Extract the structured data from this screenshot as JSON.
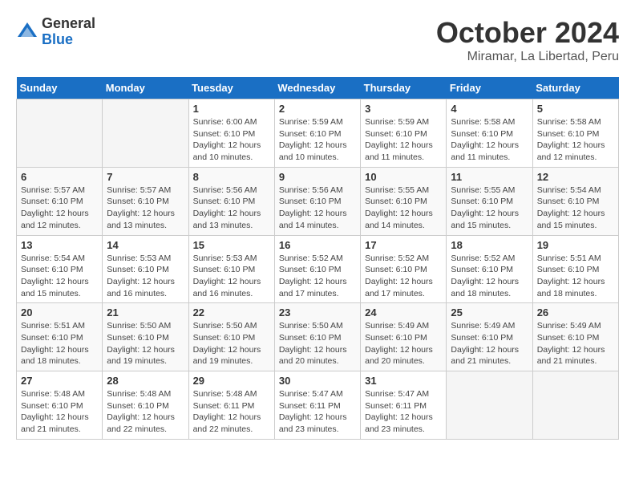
{
  "logo": {
    "general": "General",
    "blue": "Blue"
  },
  "title": "October 2024",
  "location": "Miramar, La Libertad, Peru",
  "days_of_week": [
    "Sunday",
    "Monday",
    "Tuesday",
    "Wednesday",
    "Thursday",
    "Friday",
    "Saturday"
  ],
  "weeks": [
    [
      {
        "day": "",
        "info": ""
      },
      {
        "day": "",
        "info": ""
      },
      {
        "day": "1",
        "info": "Sunrise: 6:00 AM\nSunset: 6:10 PM\nDaylight: 12 hours\nand 10 minutes."
      },
      {
        "day": "2",
        "info": "Sunrise: 5:59 AM\nSunset: 6:10 PM\nDaylight: 12 hours\nand 10 minutes."
      },
      {
        "day": "3",
        "info": "Sunrise: 5:59 AM\nSunset: 6:10 PM\nDaylight: 12 hours\nand 11 minutes."
      },
      {
        "day": "4",
        "info": "Sunrise: 5:58 AM\nSunset: 6:10 PM\nDaylight: 12 hours\nand 11 minutes."
      },
      {
        "day": "5",
        "info": "Sunrise: 5:58 AM\nSunset: 6:10 PM\nDaylight: 12 hours\nand 12 minutes."
      }
    ],
    [
      {
        "day": "6",
        "info": "Sunrise: 5:57 AM\nSunset: 6:10 PM\nDaylight: 12 hours\nand 12 minutes."
      },
      {
        "day": "7",
        "info": "Sunrise: 5:57 AM\nSunset: 6:10 PM\nDaylight: 12 hours\nand 13 minutes."
      },
      {
        "day": "8",
        "info": "Sunrise: 5:56 AM\nSunset: 6:10 PM\nDaylight: 12 hours\nand 13 minutes."
      },
      {
        "day": "9",
        "info": "Sunrise: 5:56 AM\nSunset: 6:10 PM\nDaylight: 12 hours\nand 14 minutes."
      },
      {
        "day": "10",
        "info": "Sunrise: 5:55 AM\nSunset: 6:10 PM\nDaylight: 12 hours\nand 14 minutes."
      },
      {
        "day": "11",
        "info": "Sunrise: 5:55 AM\nSunset: 6:10 PM\nDaylight: 12 hours\nand 15 minutes."
      },
      {
        "day": "12",
        "info": "Sunrise: 5:54 AM\nSunset: 6:10 PM\nDaylight: 12 hours\nand 15 minutes."
      }
    ],
    [
      {
        "day": "13",
        "info": "Sunrise: 5:54 AM\nSunset: 6:10 PM\nDaylight: 12 hours\nand 15 minutes."
      },
      {
        "day": "14",
        "info": "Sunrise: 5:53 AM\nSunset: 6:10 PM\nDaylight: 12 hours\nand 16 minutes."
      },
      {
        "day": "15",
        "info": "Sunrise: 5:53 AM\nSunset: 6:10 PM\nDaylight: 12 hours\nand 16 minutes."
      },
      {
        "day": "16",
        "info": "Sunrise: 5:52 AM\nSunset: 6:10 PM\nDaylight: 12 hours\nand 17 minutes."
      },
      {
        "day": "17",
        "info": "Sunrise: 5:52 AM\nSunset: 6:10 PM\nDaylight: 12 hours\nand 17 minutes."
      },
      {
        "day": "18",
        "info": "Sunrise: 5:52 AM\nSunset: 6:10 PM\nDaylight: 12 hours\nand 18 minutes."
      },
      {
        "day": "19",
        "info": "Sunrise: 5:51 AM\nSunset: 6:10 PM\nDaylight: 12 hours\nand 18 minutes."
      }
    ],
    [
      {
        "day": "20",
        "info": "Sunrise: 5:51 AM\nSunset: 6:10 PM\nDaylight: 12 hours\nand 18 minutes."
      },
      {
        "day": "21",
        "info": "Sunrise: 5:50 AM\nSunset: 6:10 PM\nDaylight: 12 hours\nand 19 minutes."
      },
      {
        "day": "22",
        "info": "Sunrise: 5:50 AM\nSunset: 6:10 PM\nDaylight: 12 hours\nand 19 minutes."
      },
      {
        "day": "23",
        "info": "Sunrise: 5:50 AM\nSunset: 6:10 PM\nDaylight: 12 hours\nand 20 minutes."
      },
      {
        "day": "24",
        "info": "Sunrise: 5:49 AM\nSunset: 6:10 PM\nDaylight: 12 hours\nand 20 minutes."
      },
      {
        "day": "25",
        "info": "Sunrise: 5:49 AM\nSunset: 6:10 PM\nDaylight: 12 hours\nand 21 minutes."
      },
      {
        "day": "26",
        "info": "Sunrise: 5:49 AM\nSunset: 6:10 PM\nDaylight: 12 hours\nand 21 minutes."
      }
    ],
    [
      {
        "day": "27",
        "info": "Sunrise: 5:48 AM\nSunset: 6:10 PM\nDaylight: 12 hours\nand 21 minutes."
      },
      {
        "day": "28",
        "info": "Sunrise: 5:48 AM\nSunset: 6:10 PM\nDaylight: 12 hours\nand 22 minutes."
      },
      {
        "day": "29",
        "info": "Sunrise: 5:48 AM\nSunset: 6:11 PM\nDaylight: 12 hours\nand 22 minutes."
      },
      {
        "day": "30",
        "info": "Sunrise: 5:47 AM\nSunset: 6:11 PM\nDaylight: 12 hours\nand 23 minutes."
      },
      {
        "day": "31",
        "info": "Sunrise: 5:47 AM\nSunset: 6:11 PM\nDaylight: 12 hours\nand 23 minutes."
      },
      {
        "day": "",
        "info": ""
      },
      {
        "day": "",
        "info": ""
      }
    ]
  ]
}
